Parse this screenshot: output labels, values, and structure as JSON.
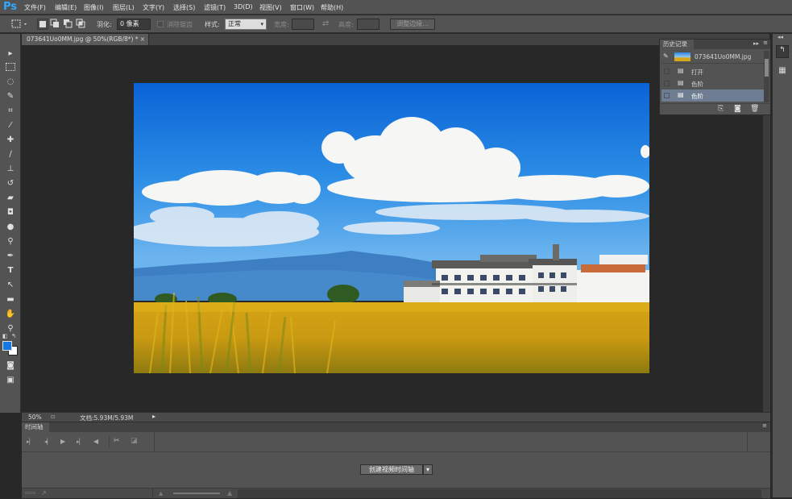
{
  "app": {
    "logo": "Ps"
  },
  "menu": [
    {
      "label": "文件(F)"
    },
    {
      "label": "编辑(E)"
    },
    {
      "label": "图像(I)"
    },
    {
      "label": "图层(L)"
    },
    {
      "label": "文字(Y)"
    },
    {
      "label": "选择(S)"
    },
    {
      "label": "滤镜(T)"
    },
    {
      "label": "3D(D)"
    },
    {
      "label": "视图(V)"
    },
    {
      "label": "窗口(W)"
    },
    {
      "label": "帮助(H)"
    }
  ],
  "options": {
    "feather_label": "羽化:",
    "feather_value": "0 像素",
    "antialias_label": "消除锯齿",
    "style_label": "样式:",
    "style_value": "正常",
    "width_label": "宽度:",
    "height_label": "高度:",
    "refine_edge": "调整边缘..."
  },
  "document": {
    "tab_title": "073641Uo0MM.jpg @ 50%(RGB/8*) *",
    "zoom": "50%",
    "doc_size": "文档:5.93M/5.93M"
  },
  "history": {
    "title": "历史记录",
    "snapshot": "073641Uo0MM.jpg",
    "items": [
      {
        "label": "打开",
        "selected": false
      },
      {
        "label": "色阶",
        "selected": false
      },
      {
        "label": "色阶",
        "selected": true
      }
    ]
  },
  "timeline": {
    "title": "时间轴",
    "create_button": "创建视频时间轴"
  },
  "colors": {
    "foreground": "#1478e0",
    "background": "#ffffff",
    "accent": "#30a8ff"
  }
}
